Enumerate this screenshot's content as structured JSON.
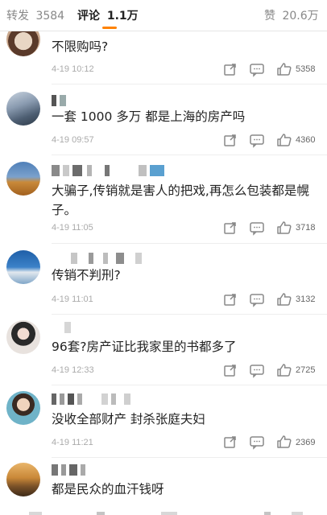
{
  "tabs": {
    "reposts_label": "转发",
    "reposts_count": "3584",
    "comments_label": "评论",
    "comments_count": "1.1万",
    "likes_label": "赞",
    "likes_count": "20.6万",
    "active_color": "#ff8200"
  },
  "comments": [
    {
      "text": "不限购吗?",
      "time": "4-19 10:12",
      "likes": "5358"
    },
    {
      "text": "一套 1000 多万 都是上海的房产吗",
      "time": "4-19 09:57",
      "likes": "4360"
    },
    {
      "text": "大骗子,传销就是害人的把戏,再怎么包装都是幌子。",
      "time": "4-19 11:05",
      "likes": "3718"
    },
    {
      "text": "传销不判刑?",
      "time": "4-19 11:01",
      "likes": "3132"
    },
    {
      "text": "96套?房产证比我家里的书都多了",
      "time": "4-19 12:33",
      "likes": "2725"
    },
    {
      "text": "没收全部财产  封杀张庭夫妇",
      "time": "4-19 11:21",
      "likes": "2369"
    },
    {
      "text": "都是民众的血汗钱呀"
    }
  ],
  "icons": {
    "share": "share-icon",
    "reply": "comment-icon",
    "like": "thumbs-up-icon"
  }
}
